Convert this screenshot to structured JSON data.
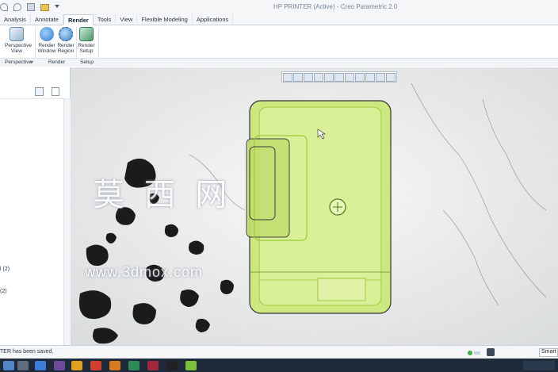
{
  "window": {
    "title": "HP PRINTER (Active) - Creo Parametric 2.0",
    "qat_icons": [
      "undo-icon",
      "redo-icon",
      "regenerate-icon",
      "open-folder-icon",
      "more-icon"
    ]
  },
  "ribbon_tabs": [
    {
      "label": "Analysis"
    },
    {
      "label": "Annotate"
    },
    {
      "label": "Render"
    },
    {
      "label": "Tools"
    },
    {
      "label": "View"
    },
    {
      "label": "Flexible Modeling"
    },
    {
      "label": "Applications"
    }
  ],
  "ribbon": {
    "buttons": [
      {
        "label1": "Perspective",
        "label2": "View",
        "icon": "perspective-view-icon",
        "color": "#6a8fb0"
      },
      {
        "label1": "Render",
        "label2": "Window",
        "icon": "render-window-icon",
        "color": "#2e79c7"
      },
      {
        "label1": "Render",
        "label2": "Region",
        "icon": "render-region-icon",
        "color": "#3b82c4"
      },
      {
        "label1": "Render",
        "label2": "Setup",
        "icon": "render-setup-icon",
        "color": "#4a9a6e"
      }
    ],
    "groups": [
      {
        "label": "Perspective"
      },
      {
        "label": "Render"
      },
      {
        "label": "Setup"
      }
    ]
  },
  "left_panel": {
    "item1": "l (2)",
    "item2": "(2)"
  },
  "viewport": {
    "watermark_cn": "莫 西 网",
    "watermark_url": "www.3dmox.com",
    "model_color": "#c8e87a",
    "model_edge": "#8bbd2a"
  },
  "status_bar": {
    "message": "TER has been saved.",
    "filter": "Smart"
  }
}
